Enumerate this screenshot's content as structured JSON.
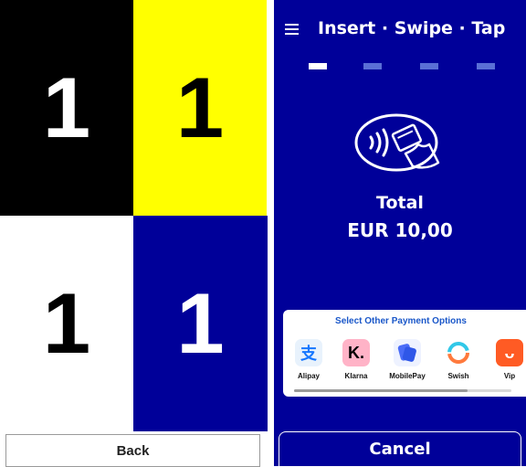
{
  "left_screen": {
    "cells": [
      {
        "label": "1",
        "color": "#000000"
      },
      {
        "label": "1",
        "color": "#ffff00"
      },
      {
        "label": "1",
        "color": "#ffffff"
      },
      {
        "label": "1",
        "color": "#000099"
      }
    ],
    "back_label": "Back"
  },
  "right_screen": {
    "menu_icon": "hamburger-icon",
    "title": "Insert · Swipe · Tap",
    "progress": {
      "total_steps": 4,
      "current_step": 1
    },
    "contactless_icon": "contactless-card-icon",
    "total_label": "Total",
    "amount": "EUR 10,00",
    "payment_panel": {
      "title": "Select Other Payment Options",
      "options": [
        {
          "label": "Alipay",
          "icon": "alipay-icon"
        },
        {
          "label": "Klarna",
          "icon": "klarna-icon"
        },
        {
          "label": "MobilePay",
          "icon": "mobilepay-icon"
        },
        {
          "label": "Swish",
          "icon": "swish-icon"
        },
        {
          "label": "Vip",
          "icon": "vipps-icon"
        }
      ]
    },
    "cancel_label": "Cancel",
    "colors": {
      "background": "#000099",
      "accent": "#1a57c9",
      "inactive_step": "#5a6fd6"
    }
  }
}
